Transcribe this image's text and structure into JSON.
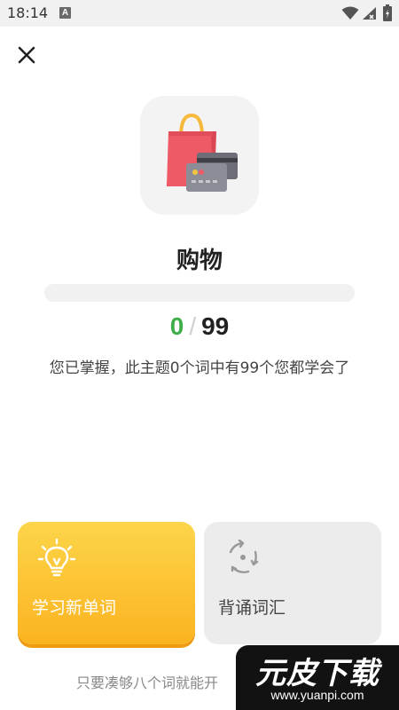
{
  "status_bar": {
    "time": "18:14",
    "notification_letter": "A"
  },
  "topic": {
    "name": "购物",
    "icon": "shopping-bag-and-cards-icon",
    "learned": 0,
    "separator": "/",
    "total": 99,
    "progress_fraction": 0,
    "description": "您已掌握，此主题0个词中有99个您都学会了"
  },
  "actions": {
    "learn_label": "学习新单词",
    "learn_icon": "lightbulb-icon",
    "review_label": "背诵词汇",
    "review_icon": "refresh-cycle-icon"
  },
  "hint": "只要凑够八个词就能开",
  "watermark": {
    "title": "元皮下载",
    "url": "www.yuanpi.com"
  },
  "colors": {
    "accent_green": "#3fae49",
    "learn_card_top": "#fdd54a",
    "learn_card_bottom": "#fbb320",
    "review_card": "#ececec"
  }
}
